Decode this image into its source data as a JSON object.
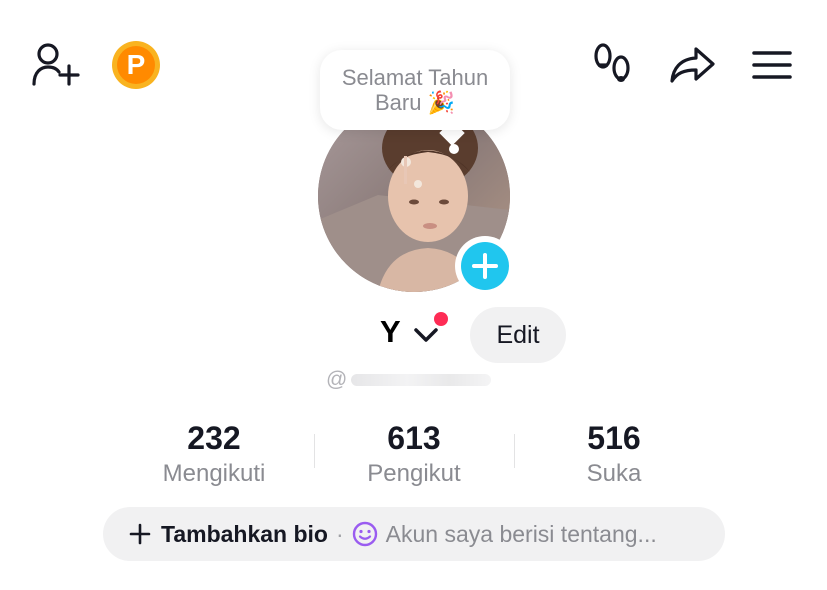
{
  "header": {
    "add_friend_icon": "person-plus-icon",
    "points_badge": {
      "letter": "P",
      "icon": "points-coin-icon",
      "color": "#ff8a00"
    },
    "footprints_icon": "footprints-icon",
    "share_icon": "share-arrow-icon",
    "menu_icon": "hamburger-menu-icon"
  },
  "bubble": {
    "line1": "Selamat Tahun",
    "line2": "Baru",
    "emoji": "🎉"
  },
  "profile": {
    "name": "Y",
    "username": "@",
    "edit_label": "Edit",
    "accent_color": "#20c6ee",
    "notification_color": "#fe2c55"
  },
  "stats": [
    {
      "value": "232",
      "label": "Mengikuti"
    },
    {
      "value": "613",
      "label": "Pengikut"
    },
    {
      "value": "516",
      "label": "Suka"
    }
  ],
  "bio": {
    "add_label": "Tambahkan bio",
    "separator": "·",
    "placeholder": "Akun saya berisi tentang..."
  }
}
